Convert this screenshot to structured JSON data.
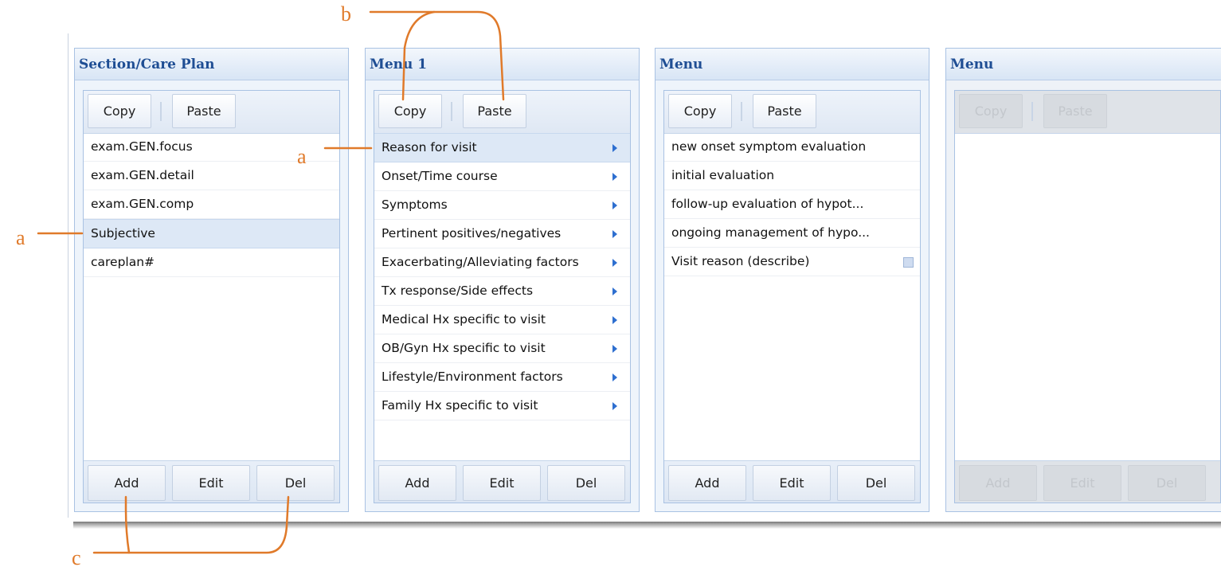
{
  "panels": [
    {
      "title": "Section/Care Plan",
      "toolbar": {
        "copy": "Copy",
        "paste": "Paste"
      },
      "items": [
        {
          "label": "exam.GEN.focus"
        },
        {
          "label": "exam.GEN.detail"
        },
        {
          "label": "exam.GEN.comp"
        },
        {
          "label": "Subjective",
          "selected": true
        },
        {
          "label": "careplan#"
        }
      ],
      "actions": {
        "add": "Add",
        "edit": "Edit",
        "del": "Del"
      }
    },
    {
      "title": "Menu 1",
      "toolbar": {
        "copy": "Copy",
        "paste": "Paste"
      },
      "items": [
        {
          "label": "Reason for visit",
          "selected": true
        },
        {
          "label": "Onset/Time course"
        },
        {
          "label": "Symptoms"
        },
        {
          "label": "Pertinent positives/negatives"
        },
        {
          "label": "Exacerbating/Alleviating factors"
        },
        {
          "label": "Tx response/Side effects"
        },
        {
          "label": "Medical Hx specific to visit"
        },
        {
          "label": "OB/Gyn Hx specific to visit"
        },
        {
          "label": "Lifestyle/Environment factors"
        },
        {
          "label": "Family Hx specific to visit"
        }
      ],
      "actions": {
        "add": "Add",
        "edit": "Edit",
        "del": "Del"
      }
    },
    {
      "title": "Menu",
      "toolbar": {
        "copy": "Copy",
        "paste": "Paste"
      },
      "items": [
        {
          "label": "new onset symptom evaluation"
        },
        {
          "label": "initial evaluation"
        },
        {
          "label": "follow-up evaluation of hypot..."
        },
        {
          "label": "ongoing management of hypo..."
        },
        {
          "label": "Visit reason (describe)"
        }
      ],
      "actions": {
        "add": "Add",
        "edit": "Edit",
        "del": "Del"
      }
    },
    {
      "title": "Menu",
      "toolbar": {
        "copy": "Copy",
        "paste": "Paste"
      },
      "items": [],
      "actions": {
        "add": "Add",
        "edit": "Edit",
        "del": "Del"
      }
    }
  ],
  "annotations": {
    "a": "a",
    "b": "b",
    "c": "c"
  },
  "colors": {
    "annotation": "#e07a2a",
    "header_text": "#1f4e94",
    "arrow": "#2e6fd0"
  }
}
